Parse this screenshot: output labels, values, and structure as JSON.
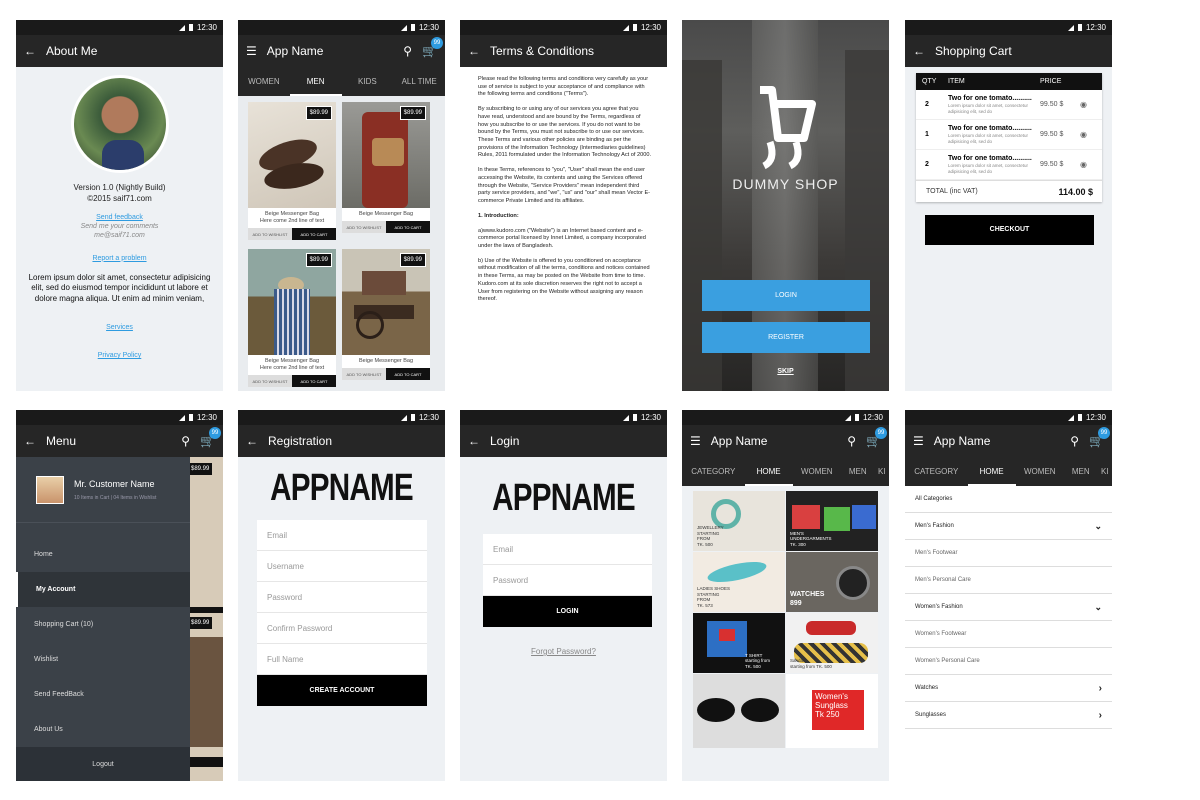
{
  "status_time": "12:30",
  "about": {
    "title": "About Me",
    "version": "Version 1.0 (Nightly Build)",
    "copyright": "©2015 saif71.com",
    "send_feedback": "Send feedback",
    "send_comments": "Send me your comments",
    "email": "me@saif71.com",
    "report_problem": "Report a problem",
    "lorem": "Lorem ipsum dolor sit amet, consectetur adipisicing elit, sed do eiusmod tempor incididunt ut labore et dolore magna aliqua. Ut enim ad minim veniam,",
    "services": "Services",
    "privacy": "Privacy Policy"
  },
  "shop": {
    "title": "App Name",
    "cart_count": "99",
    "tabs": [
      "WOMEN",
      "MEN",
      "KIDS",
      "ALL TIME"
    ],
    "products": [
      {
        "price": "$89.99",
        "name": "Beige Messenger Bag",
        "subtitle": "Here come 2nd line of text",
        "wish": "ADD TO WISHLIST",
        "add": "ADD TO CART"
      },
      {
        "price": "$89.99",
        "name": "Beige Messenger Bag",
        "subtitle": "",
        "wish": "ADD TO WISHLIST",
        "add": "ADD TO CART"
      },
      {
        "price": "$89.99",
        "name": "Beige Messenger Bag",
        "subtitle": "Here come 2nd line of text",
        "wish": "ADD TO WISHLIST",
        "add": "ADD TO CART"
      },
      {
        "price": "$89.99",
        "name": "Beige Messenger Bag",
        "subtitle": "",
        "wish": "ADD TO WISHLIST",
        "add": "ADD TO CART"
      }
    ]
  },
  "terms": {
    "title": "Terms & Conditions",
    "paragraphs": [
      "Please read the following terms and conditions very carefully as your use of service is subject to your acceptance of and compliance with the following terms and conditions (\"Terms\").",
      "By subscribing to or using any of our services you agree that you have read, understood and are bound by the Terms, regardless of how you subscribe to or use the services. If you do not want to be bound by the Terms, you must not subscribe to or use our services. These Terms and various other policies are binding as per the provisions of the Information Technology (Intermediaries guidelines) Rules, 2011 formulated under the Information Technology Act of 2000.",
      "In these Terms, references to \"you\", \"User\" shall mean the end user accessing the Website, its contents and using the Services offered through the Website, \"Service Providers\" mean independent third party service providers, and \"we\", \"us\" and \"our\" shall mean Vector E-commerce Private Limited and its affiliates.",
      "1. Introduction:",
      "a)www.kudoro.com (\"Website\") is an Internet based content and e-commerce portal licensed by Innet Limited, a company incorporated under the laws of Bangladesh.",
      "b) Use of the Website is offered to you conditioned on acceptance without modification of all the terms, conditions and notices contained in these Terms, as may be posted on the Website from time to time. Kudoro.com at its sole discretion reserves the right not to accept a User from registering on the Website without assigning any reason thereof."
    ]
  },
  "splash": {
    "brand": "DUMMY SHOP",
    "login": "LOGIN",
    "register": "REGISTER",
    "skip": "SKIP"
  },
  "cart": {
    "title": "Shopping Cart",
    "headers": [
      "QTY",
      "ITEM",
      "PRICE"
    ],
    "rows": [
      {
        "qty": "2",
        "item": "Two for one tomato..........",
        "desc": "Lorem ipsum dolor sit amet, consectetur adipisicing elit, sed do",
        "price": "99.50 $"
      },
      {
        "qty": "1",
        "item": "Two for one tomato..........",
        "desc": "Lorem ipsum dolor sit amet, consectetur adipisicing elit, sed do",
        "price": "99.50 $"
      },
      {
        "qty": "2",
        "item": "Two for one tomato..........",
        "desc": "Lorem ipsum dolor sit amet, consectetur adipisicing elit, sed do",
        "price": "99.50 $"
      }
    ],
    "total_label": "TOTAL (inc VAT)",
    "total_value": "114.00 $",
    "checkout": "CHECKOUT"
  },
  "menu": {
    "title": "Menu",
    "user_name": "Mr. Customer Name",
    "user_meta": "10 Items in Cart  |  04 Items in Wishlist",
    "items": [
      "Home",
      "My Account",
      "Shopping Cart (10)",
      "Wishlist",
      "Send FeedBack",
      "About Us"
    ],
    "logout": "Logout",
    "peek_price": "$89.99"
  },
  "registration": {
    "title": "Registration",
    "brand": "APPNAME",
    "fields": [
      "Email",
      "Username",
      "Password",
      "Confirm Password",
      "Full Name"
    ],
    "button": "CREATE ACCOUNT"
  },
  "login": {
    "title": "Login",
    "brand": "APPNAME",
    "fields": [
      "Email",
      "Password"
    ],
    "button": "LOGIN",
    "forgot": "Forgot Password?"
  },
  "home": {
    "title": "App Name",
    "cart_count": "99",
    "tabs": [
      "CATEGORY",
      "HOME",
      "WOMEN",
      "MEN",
      "KI"
    ],
    "tiles": [
      {
        "caption": "JEWELLERY\nSTARTING\nFROM\nTK. 500"
      },
      {
        "caption": "MEN'S\nUNDERGARMENTS\nTK. 300"
      },
      {
        "caption": "LADIES SHOES\nSTARTING\nFROM\nTK. 573"
      },
      {
        "caption": "WATCHES\n899"
      },
      {
        "caption": "T SHIRT\nstarting from\nTK. 500"
      },
      {
        "caption": "Sandals\nstarting from TK. 500"
      },
      {
        "caption": ""
      },
      {
        "caption": "Women's\nSunglass\nTk 250"
      }
    ]
  },
  "category": {
    "title": "App Name",
    "cart_count": "99",
    "tabs": [
      "CATEGORY",
      "HOME",
      "WOMEN",
      "MEN",
      "KI"
    ],
    "rows": [
      {
        "label": "All Categories",
        "kind": "main",
        "arrow": ""
      },
      {
        "label": "Men's Fashion",
        "kind": "main",
        "arrow": "down"
      },
      {
        "label": "Men's Footwear",
        "kind": "sub",
        "arrow": ""
      },
      {
        "label": "Men's Personal Care",
        "kind": "sub",
        "arrow": ""
      },
      {
        "label": "Women's Fashion",
        "kind": "main",
        "arrow": "down"
      },
      {
        "label": "Women's Footwear",
        "kind": "sub",
        "arrow": ""
      },
      {
        "label": "Women's Personal Care",
        "kind": "sub",
        "arrow": ""
      },
      {
        "label": "Watches",
        "kind": "main",
        "arrow": "right"
      },
      {
        "label": "Sunglasses",
        "kind": "main",
        "arrow": "right"
      }
    ]
  }
}
